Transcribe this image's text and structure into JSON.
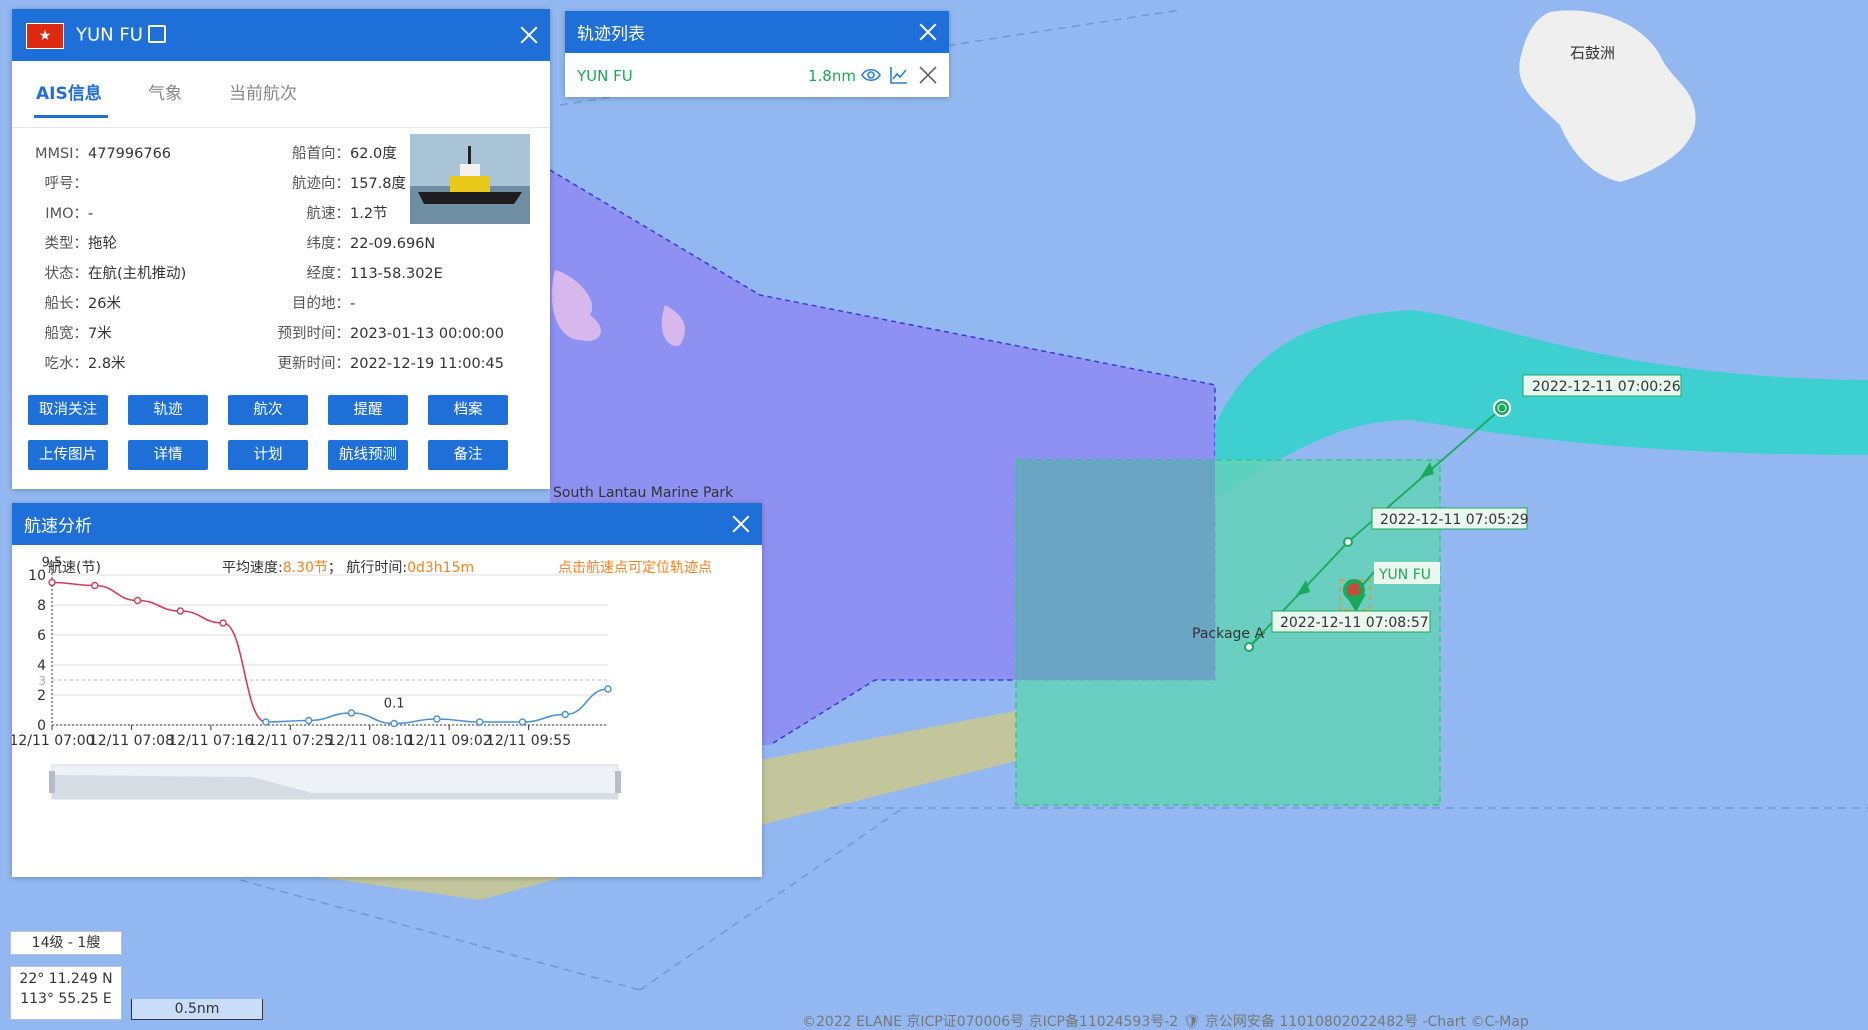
{
  "map": {
    "labels": {
      "island": "石鼓洲",
      "marine_park": "South Lantau Marine Park",
      "package": "Package A",
      "ship_label": "YUN FU"
    },
    "track_points": [
      "2022-12-11 07:00:26",
      "2022-12-11 07:05:29",
      "2022-12-11 07:08:57"
    ],
    "zoom_label": "14级 - 1艘",
    "coords": {
      "lat": "22° 11.249 N",
      "lon": "113° 55.25 E"
    },
    "scale": "0.5nm",
    "footer": "©2022 ELANE  京ICP证070006号  京ICP备11024593号-2  🛡 京公网安备 11010802022482号  -Chart ©C-Map"
  },
  "ais_panel": {
    "flag": "★",
    "name": "YUN FU",
    "tabs": [
      "AIS信息",
      "气象",
      "当前航次"
    ],
    "left_fields": [
      {
        "k": "MMSI：",
        "v": "477996766"
      },
      {
        "k": "呼号：",
        "v": ""
      },
      {
        "k": "IMO：",
        "v": "-"
      },
      {
        "k": "类型：",
        "v": "拖轮"
      },
      {
        "k": "状态：",
        "v": "在航(主机推动)"
      },
      {
        "k": "船长：",
        "v": "26米"
      },
      {
        "k": "船宽：",
        "v": "7米"
      },
      {
        "k": "吃水：",
        "v": "2.8米"
      }
    ],
    "right_fields": [
      {
        "k": "船首向：",
        "v": "62.0度"
      },
      {
        "k": "航迹向：",
        "v": "157.8度"
      },
      {
        "k": "航速：",
        "v": "1.2节"
      },
      {
        "k": "纬度：",
        "v": "22-09.696N"
      },
      {
        "k": "经度：",
        "v": "113-58.302E"
      },
      {
        "k": "目的地：",
        "v": "-"
      },
      {
        "k": "预到时间：",
        "v": "2023-01-13 00:00:00"
      },
      {
        "k": "更新时间：",
        "v": "2022-12-19 11:00:45"
      }
    ],
    "buttons": [
      "取消关注",
      "轨迹",
      "航次",
      "提醒",
      "档案",
      "上传图片",
      "详情",
      "计划",
      "航线预测",
      "备注"
    ]
  },
  "track_list": {
    "title": "轨迹列表",
    "items": [
      {
        "name": "YUN FU",
        "distance": "1.8nm"
      }
    ]
  },
  "speed_panel": {
    "title": "航速分析",
    "ylabel": "航速(节)",
    "avg_label": "平均速度:",
    "avg_value": "8.30节",
    "sep": "；",
    "time_label": "航行时间:",
    "time_value": "0d3h15m",
    "hint": "点击航速点可定位轨迹点",
    "accent_color": "#ff7f1a",
    "line_color_fast": "#d63c55",
    "line_color_slow": "#4a90d9"
  },
  "chart_data": {
    "type": "line",
    "ylabel": "航速(节)",
    "ylim": [
      0,
      10
    ],
    "yticks": [
      0,
      2,
      4,
      6,
      8,
      10
    ],
    "xticks": [
      "12/11 07:00",
      "12/11 07:08",
      "12/11 07:16",
      "12/11 07:25",
      "12/11 08:10",
      "12/11 09:02",
      "12/11 09:55"
    ],
    "x": [
      0,
      1,
      2,
      3,
      4,
      5,
      6,
      7,
      8,
      9,
      10,
      11,
      12,
      13
    ],
    "values": [
      9.5,
      9.3,
      8.3,
      7.6,
      6.8,
      0.2,
      0.3,
      0.8,
      0.1,
      0.4,
      0.2,
      0.2,
      0.7,
      2.4
    ],
    "max_label": "9.5",
    "min_label": "0.1",
    "markline": 3,
    "markline_label": "3"
  }
}
